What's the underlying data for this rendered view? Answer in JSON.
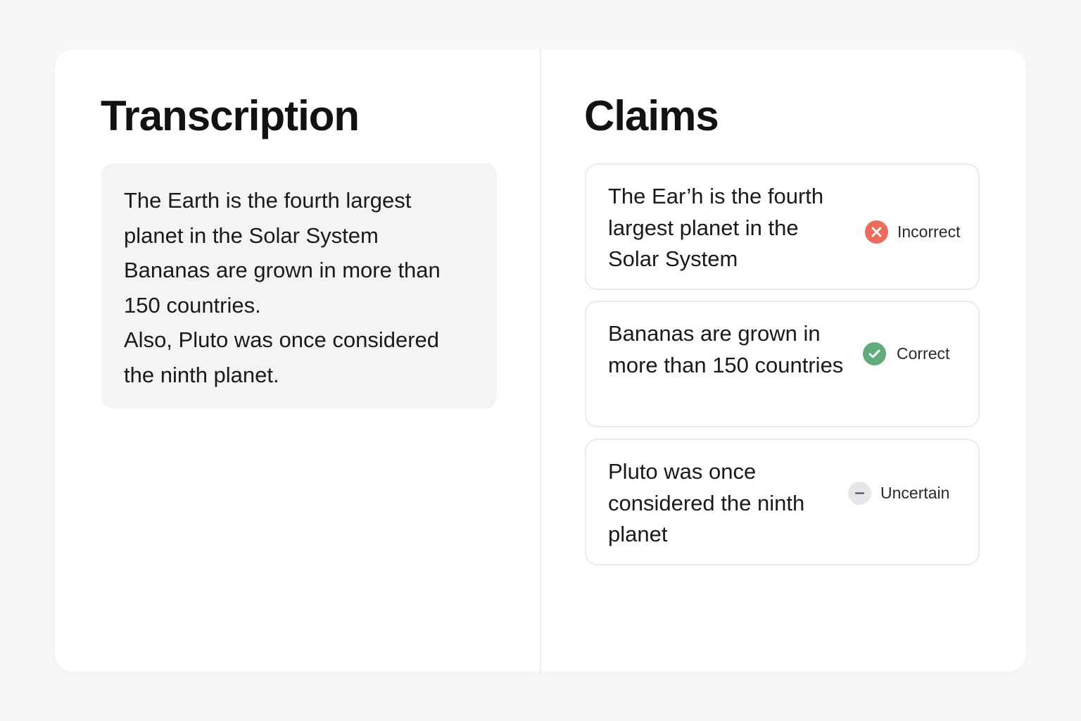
{
  "transcription": {
    "heading": "Transcription",
    "lines": [
      "The Earth is the fourth largest",
      "planet in the Solar System",
      "Bananas are grown in more than",
      "150 countries.",
      "Also, Pluto was once considered",
      "the ninth planet."
    ]
  },
  "claims": {
    "heading": "Claims",
    "items": [
      {
        "text": "The Ear’h is the fourth largest planet in the Solar System",
        "status": "Incorrect",
        "icon": "x-circle-icon",
        "color": "#ec6b5c"
      },
      {
        "text": "Bananas are grown in more than 150 countries",
        "status": "Correct",
        "icon": "check-circle-icon",
        "color": "#62ac7c"
      },
      {
        "text": "Pluto was once considered the ninth planet",
        "status": "Uncertain",
        "icon": "minus-circle-icon",
        "color": "#e6e7ea"
      }
    ]
  }
}
